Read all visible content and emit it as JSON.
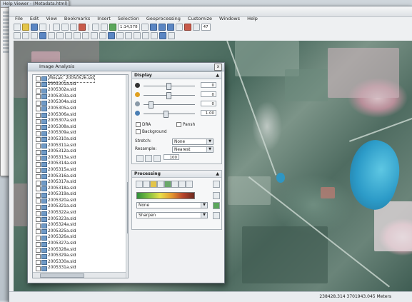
{
  "background_window": {
    "title": "Help Viewer - (Metadata.html)"
  },
  "app": {
    "menus": [
      "File",
      "Edit",
      "View",
      "Bookmarks",
      "Insert",
      "Selection",
      "Geoprocessing",
      "Customize",
      "Windows",
      "Help"
    ],
    "scale": "1:14,578",
    "zoom_field": "47"
  },
  "status": {
    "left": "",
    "mid": "",
    "right": "238428.314  3701943.045 Meters"
  },
  "dialog": {
    "title": "Image Analysis",
    "close_label": "x",
    "layers": [
      {
        "name": "Mosaic_20050526.sid",
        "checked": false,
        "selected": true
      },
      {
        "name": "2005301a.sid"
      },
      {
        "name": "2005302a.sid"
      },
      {
        "name": "2005303a.sid"
      },
      {
        "name": "2005304a.sid"
      },
      {
        "name": "2005305a.sid"
      },
      {
        "name": "2005306a.sid"
      },
      {
        "name": "2005307a.sid"
      },
      {
        "name": "2005308a.sid"
      },
      {
        "name": "2005309a.sid"
      },
      {
        "name": "2005310a.sid"
      },
      {
        "name": "2005311a.sid"
      },
      {
        "name": "2005312a.sid"
      },
      {
        "name": "2005313a.sid"
      },
      {
        "name": "2005314a.sid"
      },
      {
        "name": "2005315a.sid"
      },
      {
        "name": "2005316a.sid"
      },
      {
        "name": "2005317a.sid"
      },
      {
        "name": "2005318a.sid"
      },
      {
        "name": "2005319a.sid"
      },
      {
        "name": "2005320a.sid"
      },
      {
        "name": "2005321a.sid"
      },
      {
        "name": "2005322a.sid"
      },
      {
        "name": "2005323a.sid"
      },
      {
        "name": "2005324a.sid"
      },
      {
        "name": "2005325a.sid"
      },
      {
        "name": "2005326a.sid"
      },
      {
        "name": "2005327a.sid"
      },
      {
        "name": "2005328a.sid"
      },
      {
        "name": "2005329a.sid"
      },
      {
        "name": "2005330a.sid"
      },
      {
        "name": "2005331a.sid"
      }
    ],
    "display": {
      "header": "Display",
      "sliders": [
        {
          "icon": "contrast-icon",
          "value": "0",
          "color": "#333333",
          "pos": 0.45
        },
        {
          "icon": "brightness-icon",
          "value": "0",
          "color": "#e0a020",
          "pos": 0.45
        },
        {
          "icon": "transparency-icon",
          "value": "0",
          "color": "#8a9aa8",
          "pos": 0.1
        },
        {
          "icon": "gamma-icon",
          "value": "1.00",
          "color": "#4a7fb5",
          "pos": 0.4
        }
      ],
      "dra_label": "DRA",
      "pansharpen_label": "Pansh",
      "background_label": "Background",
      "stretch_label": "Stretch:",
      "stretch_value": "None",
      "resample_label": "Resample:",
      "resample_value": "Nearest",
      "apply_value": "100"
    },
    "processing": {
      "header": "Processing",
      "function1": "None",
      "function2": "Sharpen"
    }
  }
}
